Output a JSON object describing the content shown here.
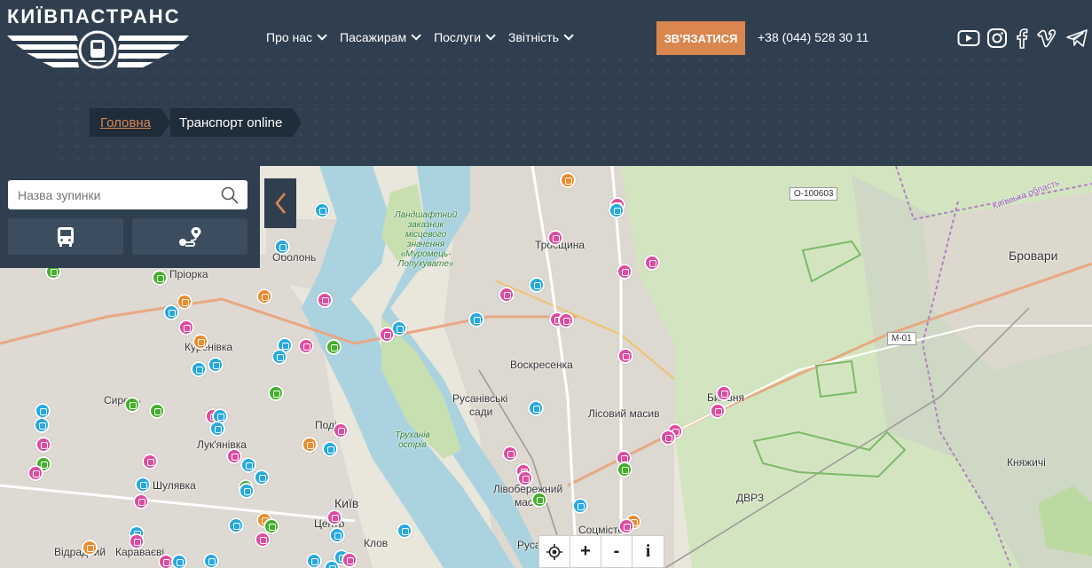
{
  "logo": {
    "text": "КИЇВПАСТРАНС"
  },
  "nav": [
    {
      "label": "Про нас"
    },
    {
      "label": "Пасажирам"
    },
    {
      "label": "Послуги"
    },
    {
      "label": "Звітність"
    }
  ],
  "cta": {
    "label": "ЗВ'ЯЗАТИСЯ"
  },
  "phone": "+38 (044) 528 30 11",
  "social": [
    "youtube-icon",
    "instagram-icon",
    "facebook-icon",
    "viber-icon",
    "telegram-icon"
  ],
  "breadcrumb": {
    "home": "Головна",
    "current": "Транспорт online"
  },
  "panel": {
    "search_placeholder": "Назва зупинки"
  },
  "map": {
    "places": {
      "obolon": "Оболонь",
      "priorka": "Пріорка",
      "kurenivka": "Куренівка",
      "syrets": "Сирець",
      "lukianivka": "Лук'янівка",
      "shuliavka": "Шулявка",
      "kyiv": "Київ",
      "tsentr": "Центр",
      "klov": "Клов",
      "vidradnyi": "Відрадний",
      "karavaievi": "Караваєві",
      "troieshchyna": "Троєщина",
      "voskresenka": "Воскресенка",
      "rusanivski": "Русанівські",
      "sady": "сади",
      "lisovyi": "Лісовий масив",
      "livoberezhnyi": "Лівобережний",
      "masyv": "масив",
      "brovary": "Бровари",
      "bykivnia": "Биківня",
      "kniazhychi": "Княжичі",
      "dvrz": "ДВРЗ",
      "podil": "Поділ",
      "rusanivka": "Русанівка",
      "sotsmisto": "Соцмісто",
      "kyiv_oblast": "Київська область",
      "reserve": "Ландшафтний заказник місцевого значення «Муромець-Лопухувате»",
      "trukhaniv": "Труханів острів"
    },
    "roads": {
      "o100603": "О-100603",
      "m01": "М-01"
    }
  },
  "controls": {
    "zoom_in": "+",
    "zoom_out": "-",
    "info": "i"
  }
}
